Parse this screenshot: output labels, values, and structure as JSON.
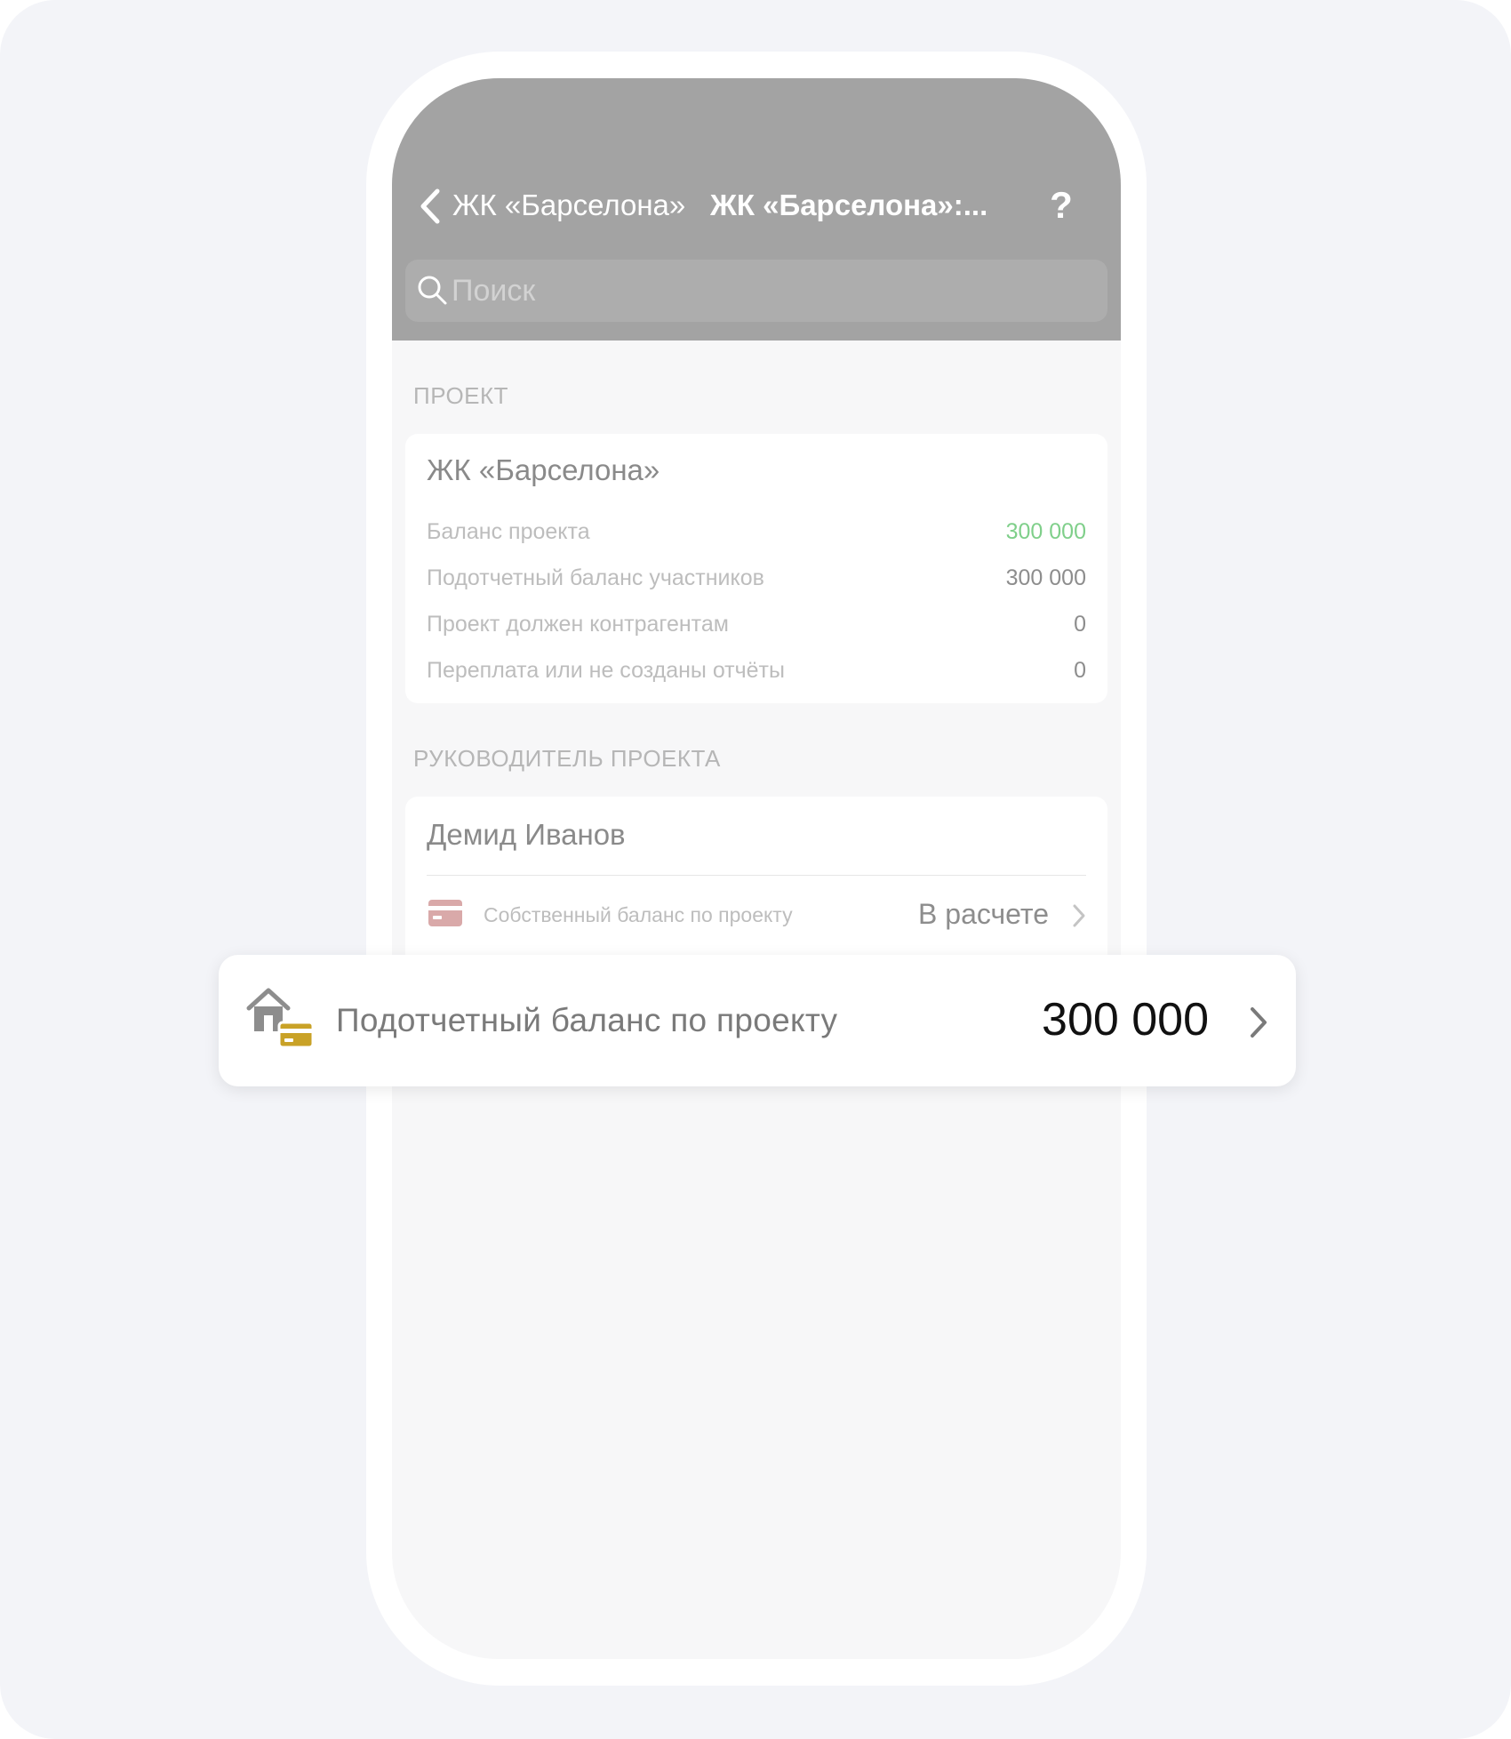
{
  "header": {
    "back_label": "ЖК «Барселона»",
    "title": "ЖК «Барселона»:...",
    "help_label": "?",
    "search_placeholder": "Поиск"
  },
  "project_section": {
    "label": "ПРОЕКТ",
    "card": {
      "title": "ЖК «Барселона»",
      "rows": [
        {
          "label": "Баланс проекта",
          "value": "300 000",
          "color": "#7fcf8a"
        },
        {
          "label": "Подотчетный баланс участников",
          "value": "300 000"
        },
        {
          "label": "Проект должен контрагентам",
          "value": "0"
        },
        {
          "label": "Переплата или не созданы отчёты",
          "value": "0"
        }
      ]
    }
  },
  "manager_section": {
    "label": "РУКОВОДИТЕЛЬ ПРОЕКТА",
    "name": "Демид Иванов",
    "own_balance": {
      "icon": "credit-card-icon",
      "label": "Собственный баланс по проекту",
      "value": "В расчете"
    }
  },
  "highlight": {
    "icon": "house-card-icon",
    "label": "Подотчетный баланс по проекту",
    "value": "300 000"
  },
  "colors": {
    "header_bg": "#a3a3a3",
    "positive": "#7fcf8a",
    "card_icon": "#d9a9a9",
    "accent_gold": "#c9a227"
  }
}
